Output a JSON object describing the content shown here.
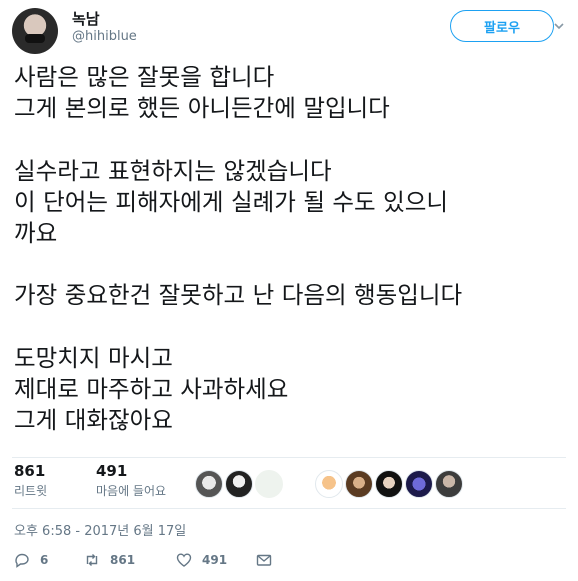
{
  "header": {
    "display_name": "녹남",
    "handle": "@hihiblue",
    "follow_label": "팔로우"
  },
  "tweet": {
    "paragraphs": [
      [
        "사람은 많은 잘못을 합니다",
        "그게 본의로 했든 아니든간에 말입니다"
      ],
      [
        "실수라고 표현하지는 않겠습니다",
        "이 단어는 피해자에게 실례가 될 수도 있으니",
        "까요"
      ],
      [
        "가장 중요한건 잘못하고 난 다음의 행동입니다"
      ],
      [
        "도망치지 마시고",
        "제대로 마주하고 사과하세요",
        "그게 대화잖아요"
      ]
    ]
  },
  "stats": {
    "retweets_count": "861",
    "retweets_label": "리트윗",
    "likes_count": "491",
    "likes_label": "마음에 들어요"
  },
  "timestamp": "오후 6:58 - 2017년 6월 17일",
  "actions": {
    "reply_count": "6",
    "retweet_count": "861",
    "like_count": "491"
  },
  "icons": [
    "reply-icon",
    "retweet-icon",
    "heart-icon",
    "envelope-icon",
    "chevron-down-icon"
  ],
  "colors": {
    "accent": "#1da1f2",
    "muted": "#657786",
    "text": "#14171a"
  }
}
